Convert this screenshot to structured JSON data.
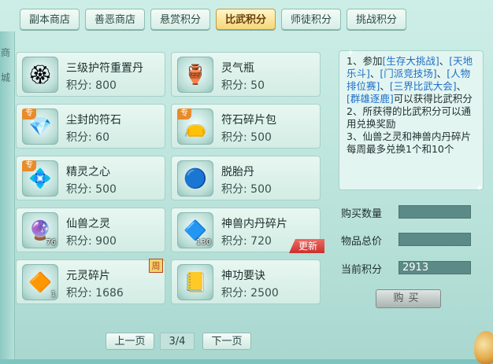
{
  "tabs": [
    {
      "label": "副本商店",
      "active": false
    },
    {
      "label": "善恶商店",
      "active": false
    },
    {
      "label": "悬赏积分",
      "active": false
    },
    {
      "label": "比武积分",
      "active": true
    },
    {
      "label": "师徒积分",
      "active": false
    },
    {
      "label": "挑战积分",
      "active": false
    }
  ],
  "left_edge_text": [
    "商",
    "城"
  ],
  "score_label": "积分:",
  "items": [
    {
      "name": "三级护符重置丹",
      "score": "800",
      "icon": "golden-charm-icon",
      "badge": "",
      "qty": "",
      "corner": ""
    },
    {
      "name": "灵气瓶",
      "score": "50",
      "icon": "spirit-bottle-icon",
      "badge": "",
      "qty": "",
      "corner": ""
    },
    {
      "name": "尘封的符石",
      "score": "60",
      "icon": "sealed-rune-stone-icon",
      "badge": "专",
      "qty": "",
      "corner": ""
    },
    {
      "name": "符石碎片包",
      "score": "500",
      "icon": "rune-fragment-bag-icon",
      "badge": "专",
      "qty": "",
      "corner": ""
    },
    {
      "name": "精灵之心",
      "score": "500",
      "icon": "spirit-heart-icon",
      "badge": "专",
      "qty": "",
      "corner": ""
    },
    {
      "name": "脱胎丹",
      "score": "500",
      "icon": "rebirth-pill-icon",
      "badge": "",
      "qty": "",
      "corner": ""
    },
    {
      "name": "仙兽之灵",
      "score": "900",
      "icon": "beast-spirit-orb-icon",
      "badge": "",
      "qty": "76",
      "corner": ""
    },
    {
      "name": "神兽内丹碎片",
      "score": "720",
      "icon": "divine-beast-core-shard-icon",
      "badge": "",
      "qty": "130",
      "corner": "更新"
    },
    {
      "name": "元灵碎片",
      "score": "1686",
      "icon": "yuanling-fragment-icon",
      "badge": "",
      "qty": "1",
      "corner": "周"
    },
    {
      "name": "神功要诀",
      "score": "2500",
      "icon": "skill-book-icon",
      "badge": "",
      "qty": "",
      "corner": ""
    }
  ],
  "pager": {
    "prev": "上一页",
    "page": "3/4",
    "next": "下一页"
  },
  "info": {
    "l1a": "1、参加",
    "l1b": "[生存大挑战]",
    "l1c": "、",
    "l1d": "[天地乐斗]",
    "l1e": "、",
    "l1f": "[门派竞技场]",
    "l1g": "、",
    "l1h": "[人物排位赛]",
    "l1i": "、",
    "l1j": "[三界比武大会]",
    "l1k": "、",
    "l1l": "[群雄逐鹿]",
    "l1m": "可以获得比武积分",
    "l2": "2、所获得的比武积分可以通用兑换奖励",
    "l3": "3、仙兽之灵和神兽内丹碎片每周最多兑换1个和10个"
  },
  "form": {
    "qty_label": "购买数量",
    "qty_value": "",
    "total_label": "物品总价",
    "total_value": "",
    "current_label": "当前积分",
    "current_value": "2913",
    "buy": "购买"
  }
}
